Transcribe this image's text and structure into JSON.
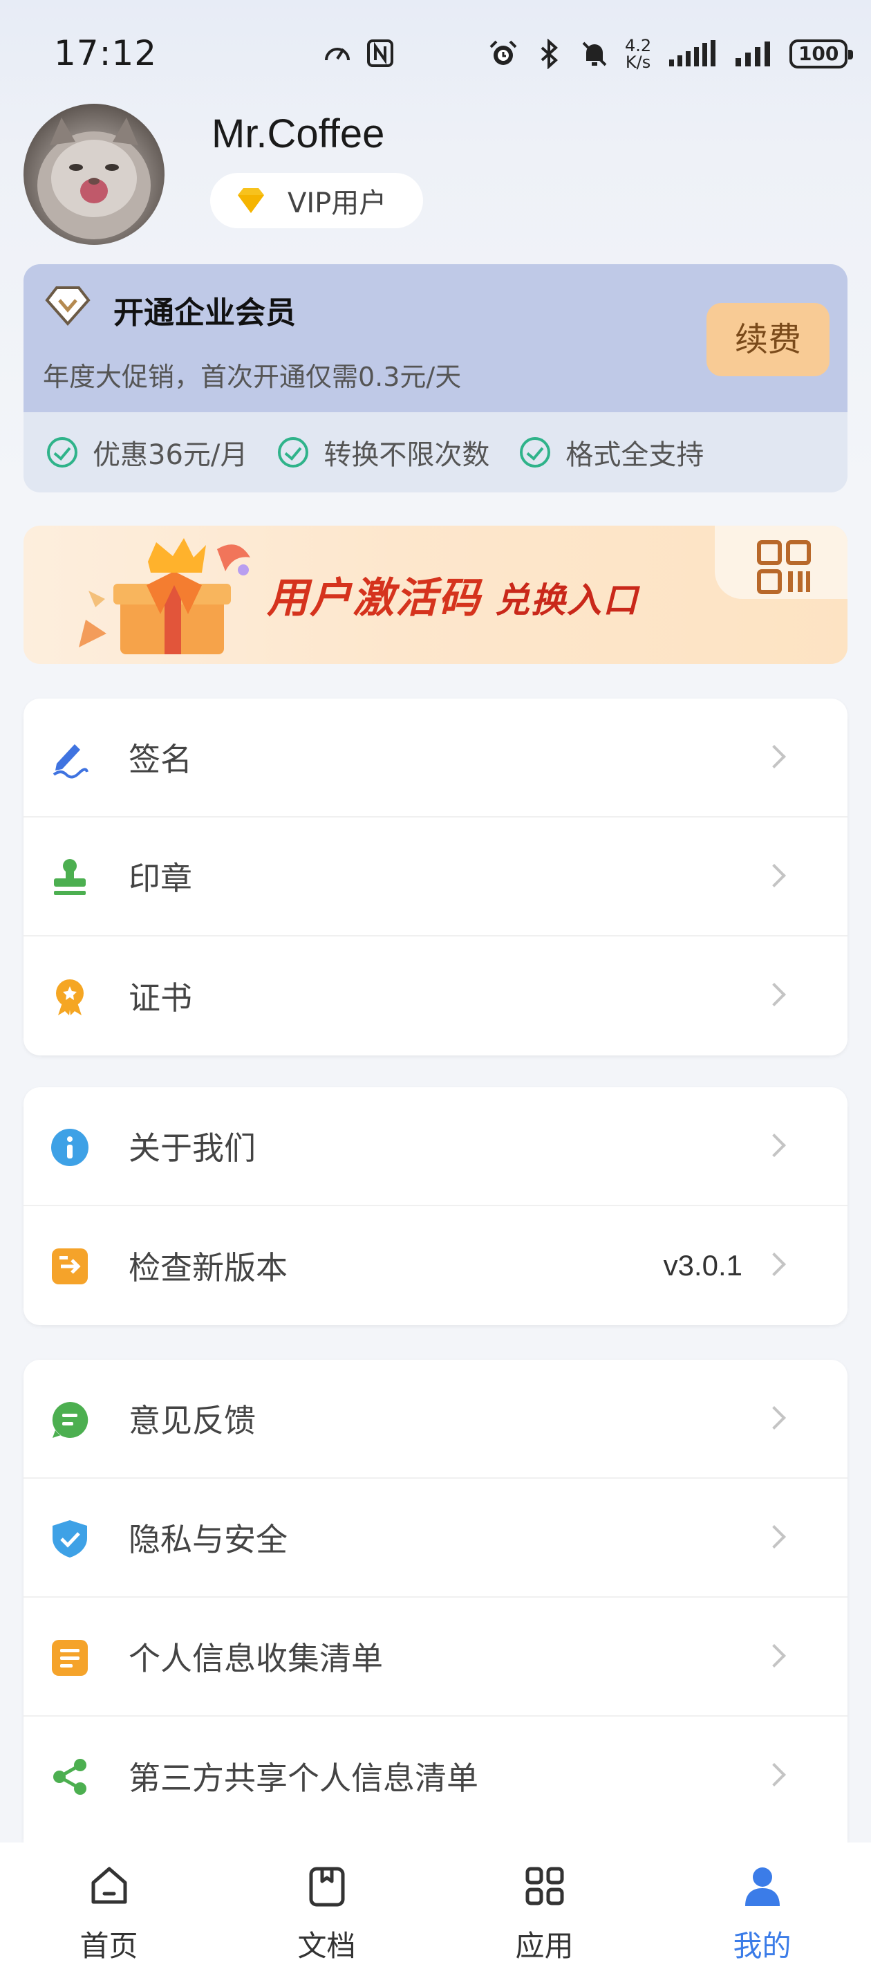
{
  "status_bar": {
    "time": "17:12",
    "net_speed_value": "4.2",
    "net_speed_unit": "K/s",
    "battery": "100",
    "icons": [
      "speedometer-icon",
      "nfc-icon",
      "alarm-icon",
      "bluetooth-icon",
      "mute-icon",
      "signal-icon",
      "signal-icon",
      "battery-icon"
    ]
  },
  "profile": {
    "username": "Mr.Coffee",
    "vip_label": "VIP用户",
    "avatar_icon": "cat-avatar"
  },
  "membership": {
    "title": "开通企业会员",
    "subtitle": "年度大促销，首次开通仅需0.3元/天",
    "renew_label": "续费",
    "features": [
      "优惠36元/月",
      "转换不限次数",
      "格式全支持"
    ]
  },
  "banner": {
    "text_main": "用户激活码",
    "text_sub": "兑换入口",
    "icon": "qr-code-icon"
  },
  "menu_groups": [
    {
      "items": [
        {
          "label": "签名",
          "icon": "signature-icon",
          "color": "#3f73e0"
        },
        {
          "label": "印章",
          "icon": "stamp-icon",
          "color": "#4caf50"
        },
        {
          "label": "证书",
          "icon": "certificate-icon",
          "color": "#f5a623"
        }
      ]
    },
    {
      "items": [
        {
          "label": "关于我们",
          "icon": "info-icon",
          "color": "#3ea1e6"
        },
        {
          "label": "检查新版本",
          "icon": "update-icon",
          "color": "#f5a32a",
          "value": "v3.0.1"
        }
      ]
    },
    {
      "items": [
        {
          "label": "意见反馈",
          "icon": "feedback-icon",
          "color": "#4caf50"
        },
        {
          "label": "隐私与安全",
          "icon": "shield-icon",
          "color": "#3ea1e6"
        },
        {
          "label": "个人信息收集清单",
          "icon": "list-icon",
          "color": "#f5a32a"
        },
        {
          "label": "第三方共享个人信息清单",
          "icon": "share-icon",
          "color": "#4caf50"
        }
      ]
    }
  ],
  "bottom_nav": {
    "items": [
      {
        "label": "首页",
        "icon": "home-icon"
      },
      {
        "label": "文档",
        "icon": "document-icon"
      },
      {
        "label": "应用",
        "icon": "apps-icon"
      },
      {
        "label": "我的",
        "icon": "profile-icon"
      }
    ],
    "active_index": 3,
    "active_color": "#3b7ce8"
  }
}
